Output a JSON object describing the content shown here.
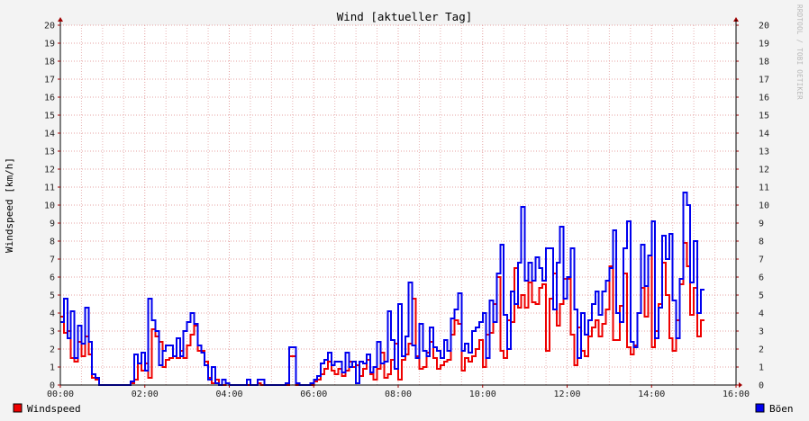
{
  "chart_data": {
    "type": "line",
    "title": "Wind [aktueller Tag]",
    "ylabel": "Windspeed [km/h]",
    "xlabel": "",
    "ylim": [
      0,
      20
    ],
    "yticks": [
      0,
      1,
      2,
      3,
      4,
      5,
      6,
      7,
      8,
      9,
      10,
      11,
      12,
      13,
      14,
      15,
      16,
      17,
      18,
      19,
      20
    ],
    "xlim_hours": [
      0,
      16
    ],
    "xticks": [
      {
        "h": 0,
        "label": "00:00"
      },
      {
        "h": 2,
        "label": "02:00"
      },
      {
        "h": 4,
        "label": "04:00"
      },
      {
        "h": 6,
        "label": "06:00"
      },
      {
        "h": 8,
        "label": "08:00"
      },
      {
        "h": 10,
        "label": "10:00"
      },
      {
        "h": 12,
        "label": "12:00"
      },
      {
        "h": 14,
        "label": "14:00"
      },
      {
        "h": 16,
        "label": "16:00"
      }
    ],
    "grid": true,
    "step_minutes": 5,
    "legend": [
      {
        "name": "Windspeed",
        "color": "#ee0000",
        "position": "bottom-left"
      },
      {
        "name": "Böen",
        "color": "#0000ee",
        "position": "bottom-right"
      }
    ],
    "watermark": "RRDTOOL / TOBI OETIKER",
    "series": [
      {
        "name": "Windspeed",
        "color": "#ee0000",
        "values": [
          3.8,
          2.9,
          3.0,
          1.5,
          1.3,
          2.4,
          1.6,
          2.7,
          1.7,
          0.4,
          0.3,
          0,
          0,
          0,
          0,
          0,
          0,
          0,
          0,
          0,
          0.1,
          0.3,
          1.2,
          0.8,
          1.2,
          0.4,
          3.1,
          2.7,
          2.4,
          1.0,
          1.4,
          1.5,
          1.6,
          1.5,
          1.9,
          1.5,
          2.2,
          2.8,
          3.3,
          1.9,
          1.9,
          1.3,
          0.4,
          0.1,
          0.3,
          0,
          0,
          0.1,
          0,
          0,
          0,
          0,
          0,
          0,
          0,
          0,
          0.1,
          0,
          0,
          0,
          0,
          0,
          0,
          0,
          0,
          1.6,
          1.6,
          0,
          0,
          0,
          0,
          0,
          0.2,
          0.3,
          0.6,
          0.9,
          1.3,
          0.8,
          0.6,
          0.9,
          0.5,
          0.8,
          1.3,
          1.0,
          1.1,
          0.5,
          0.9,
          1.4,
          0.6,
          0.3,
          0.9,
          1.8,
          0.4,
          0.6,
          1.4,
          2.3,
          0.3,
          1.4,
          1.7,
          2.3,
          4.8,
          1.6,
          0.9,
          1.0,
          1.8,
          2.4,
          1.5,
          0.9,
          1.1,
          1.3,
          1.4,
          2.8,
          3.6,
          3.4,
          0.8,
          1.5,
          1.3,
          1.6,
          2.0,
          2.5,
          1.0,
          2.8,
          2.9,
          4.5,
          6.0,
          1.9,
          1.5,
          3.6,
          3.5,
          6.5,
          4.3,
          5.0,
          4.3,
          5.7,
          4.6,
          4.5,
          5.4,
          5.6,
          1.9,
          4.8,
          6.2,
          3.3,
          4.5,
          5.9,
          5.9,
          2.8,
          1.1,
          3.2,
          1.9,
          1.6,
          2.7,
          3.2,
          3.6,
          2.7,
          3.4,
          4.2,
          6.6,
          2.5,
          2.5,
          4.4,
          6.2,
          2.1,
          1.7,
          2.2,
          4.0,
          5.4,
          3.8,
          7.2,
          2.1,
          3.0,
          4.5,
          6.8,
          5.0,
          2.6,
          1.9,
          3.6,
          5.6,
          7.9,
          6.6,
          3.9,
          5.4,
          2.7,
          3.6
        ]
      },
      {
        "name": "Böen",
        "color": "#0000ee",
        "values": [
          3.5,
          4.8,
          2.6,
          4.1,
          1.5,
          3.3,
          2.3,
          4.3,
          2.4,
          0.6,
          0.4,
          0,
          0,
          0,
          0,
          0,
          0,
          0,
          0,
          0,
          0.2,
          1.7,
          1.2,
          1.8,
          0.8,
          4.8,
          3.6,
          3.0,
          1.1,
          1.9,
          2.2,
          2.2,
          1.6,
          2.6,
          1.6,
          3.0,
          3.5,
          4.0,
          3.4,
          2.2,
          1.8,
          1.1,
          0.3,
          1.0,
          0.1,
          0,
          0.3,
          0.1,
          0,
          0,
          0,
          0,
          0,
          0.3,
          0,
          0,
          0.3,
          0.3,
          0,
          0,
          0,
          0,
          0,
          0,
          0.1,
          2.1,
          2.1,
          0.1,
          0,
          0,
          0,
          0.1,
          0.3,
          0.5,
          1.2,
          1.4,
          1.8,
          1.1,
          1.3,
          1.3,
          0.7,
          1.8,
          1.0,
          1.3,
          0.1,
          1.3,
          1.2,
          1.7,
          0.7,
          1.0,
          2.4,
          1.2,
          1.3,
          4.1,
          2.5,
          0.9,
          4.5,
          1.6,
          2.7,
          5.7,
          2.2,
          1.5,
          3.4,
          1.9,
          1.6,
          3.2,
          2.1,
          1.9,
          1.5,
          2.5,
          1.9,
          3.7,
          4.2,
          5.1,
          1.9,
          2.3,
          1.8,
          3.0,
          3.2,
          3.5,
          4.0,
          1.5,
          4.7,
          3.5,
          6.2,
          7.8,
          3.9,
          2.0,
          5.2,
          4.5,
          6.8,
          9.9,
          5.8,
          6.8,
          5.8,
          7.1,
          6.5,
          5.8,
          7.6,
          7.6,
          4.2,
          6.8,
          8.8,
          4.8,
          6.0,
          7.6,
          4.2,
          1.5,
          4.0,
          2.8,
          3.6,
          4.5,
          5.2,
          3.9,
          5.2,
          5.8,
          6.5,
          8.6,
          4.0,
          3.5,
          7.6,
          9.1,
          2.4,
          2.1,
          4.0,
          7.8,
          5.5,
          7.2,
          9.1,
          2.6,
          4.3,
          8.3,
          7.0,
          8.4,
          4.7,
          2.6,
          5.9,
          10.7,
          10.0,
          5.7,
          8.0,
          4.0,
          5.3
        ]
      }
    ]
  }
}
